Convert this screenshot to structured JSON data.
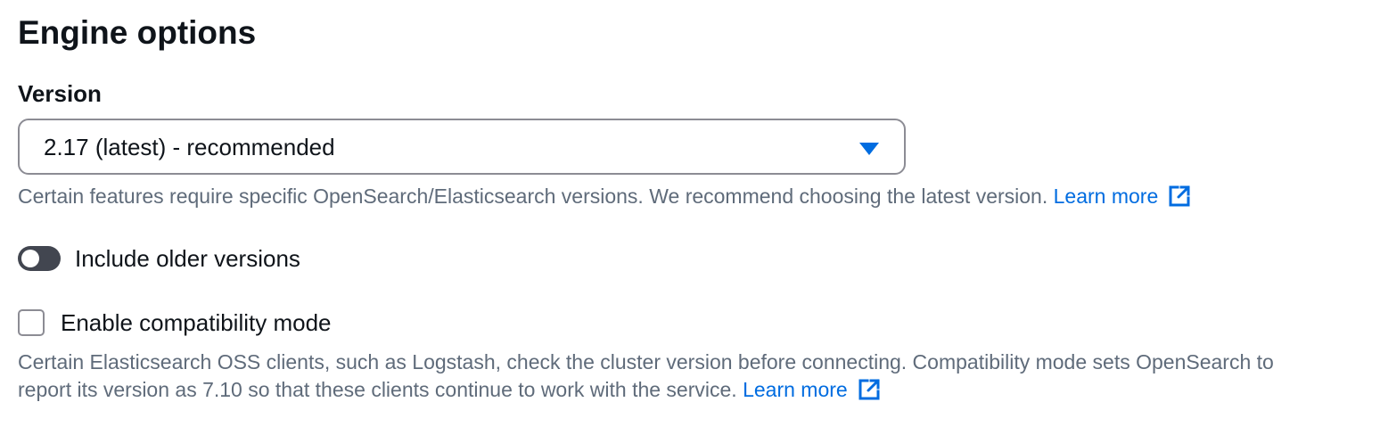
{
  "section": {
    "title": "Engine options"
  },
  "version": {
    "label": "Version",
    "selected": "2.17 (latest) - recommended",
    "hint_text": "Certain features require specific OpenSearch/Elasticsearch versions. We recommend choosing the latest version.",
    "learn_more": "Learn more"
  },
  "older_versions": {
    "label": "Include older versions",
    "enabled": false
  },
  "compatibility": {
    "label": "Enable compatibility mode",
    "checked": false,
    "hint_line1": "Certain Elasticsearch OSS clients, such as Logstash, check the cluster version before connecting. Compatibility mode sets OpenSearch to",
    "hint_line2": "report its version as 7.10 so that these clients continue to work with the service.",
    "learn_more": "Learn more"
  },
  "icons": {
    "dropdown": "caret-down-icon",
    "external_link": "external-link-icon"
  },
  "colors": {
    "link": "#006ce0",
    "text": "#0f141a",
    "secondary_text": "#5f6b7a",
    "border": "#8c8c94",
    "toggle_off": "#424650"
  }
}
